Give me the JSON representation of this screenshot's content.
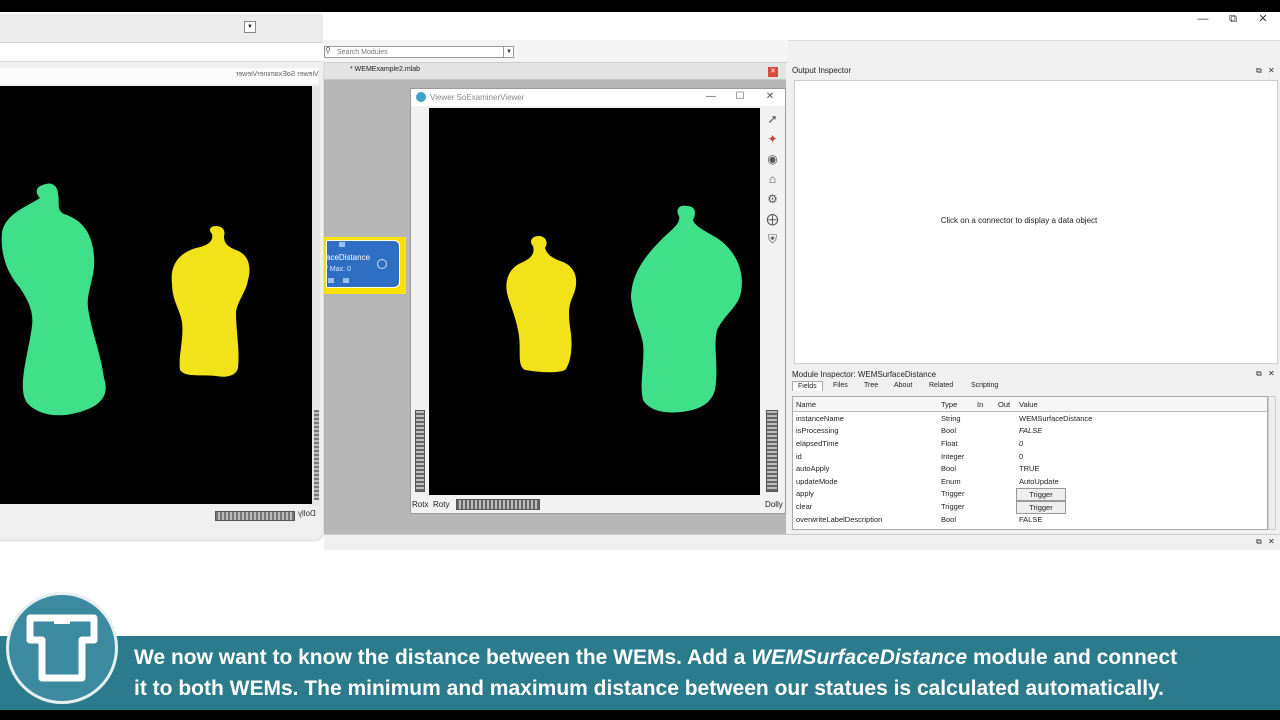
{
  "app": {
    "window_controls": [
      "minimize",
      "restore",
      "close"
    ],
    "search_placeholder": "Search Modules",
    "document_tab": "* WEMExample2.mlab"
  },
  "left_viewer": {
    "title": "Viewer SoExaminerViewer",
    "thumbwheel_label": "Dolly"
  },
  "network": {
    "module_label": "aceDistance",
    "module_sub": "/ Max: 0"
  },
  "viewer": {
    "title": "Viewer SoExaminerViewer",
    "rotx_label": "Rotx",
    "roty_label": "Roty",
    "dolly_label": "Dolly",
    "tools": [
      "pick-arrow-icon",
      "view-all-icon",
      "seek-icon",
      "home-icon",
      "set-home-icon",
      "projection-icon",
      "shield-icon"
    ]
  },
  "output_inspector": {
    "title": "Output Inspector",
    "message": "Click on a connector to display a data object"
  },
  "module_inspector": {
    "title": "Module Inspector: WEMSurfaceDistance",
    "tabs": [
      "Fields",
      "Files",
      "Tree",
      "About",
      "Related",
      "Scripting"
    ],
    "columns": [
      "Name",
      "Type",
      "In",
      "Out",
      "Value"
    ],
    "rows": [
      {
        "name": "instanceName",
        "type": "String",
        "value": "WEMSurfaceDistance"
      },
      {
        "name": "isProcessing",
        "type": "Bool",
        "value": "FALSE"
      },
      {
        "name": "elapsedTime",
        "type": "Float",
        "value": "0"
      },
      {
        "name": "id",
        "type": "Integer",
        "value": "0"
      },
      {
        "name": "autoApply",
        "type": "Bool",
        "value": "TRUE"
      },
      {
        "name": "updateMode",
        "type": "Enum",
        "value": "AutoUpdate"
      },
      {
        "name": "apply",
        "type": "Trigger",
        "value": "Trigger"
      },
      {
        "name": "clear",
        "type": "Trigger",
        "value": "Trigger"
      },
      {
        "name": "overwriteLabelDescription",
        "type": "Bool",
        "value": "FALSE"
      }
    ]
  },
  "caption": {
    "line1_a": "We now want to know the distance between the WEMs. Add a ",
    "line1_em": "WEMSurfaceDistance",
    "line1_b": " module and connect",
    "line2": "it to both WEMs. The minimum and maximum distance between our statues is calculated automatically."
  },
  "colors": {
    "caption_bg": "#2b7b8c",
    "green_statue": "#3fe089",
    "yellow_statue": "#f2e21a",
    "module_blue": "#2e6fc4",
    "module_highlight": "#ffe100"
  }
}
